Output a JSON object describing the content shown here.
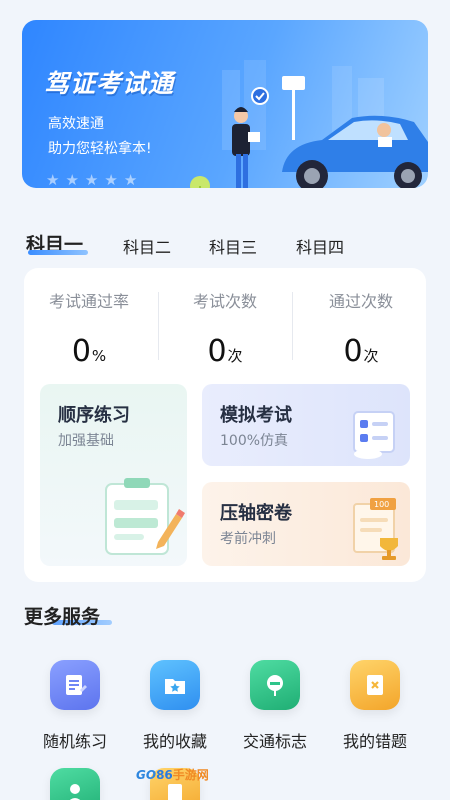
{
  "banner": {
    "title": "驾证考试通",
    "line1": "高效速通",
    "line2": "助力您轻松拿本!",
    "star_count": 5
  },
  "tabs": [
    {
      "label": "科目一",
      "active": true
    },
    {
      "label": "科目二",
      "active": false
    },
    {
      "label": "科目三",
      "active": false
    },
    {
      "label": "科目四",
      "active": false
    }
  ],
  "stats": [
    {
      "label": "考试通过率",
      "value": "0",
      "unit": "%"
    },
    {
      "label": "考试次数",
      "value": "0",
      "unit": "次"
    },
    {
      "label": "通过次数",
      "value": "0",
      "unit": "次"
    }
  ],
  "practice": {
    "sequential": {
      "title": "顺序练习",
      "subtitle": "加强基础"
    },
    "mock": {
      "title": "模拟考试",
      "subtitle": "100%仿真"
    },
    "final": {
      "title": "压轴密卷",
      "subtitle": "考前冲刺"
    }
  },
  "more_services": {
    "title": "更多服务",
    "items": [
      {
        "label": "随机练习",
        "icon": "random-practice-icon",
        "color": "#6f86f5"
      },
      {
        "label": "我的收藏",
        "icon": "favorites-folder-icon",
        "color": "#3aa6ef"
      },
      {
        "label": "交通标志",
        "icon": "traffic-sign-icon",
        "color": "#2fc48a"
      },
      {
        "label": "我的错题",
        "icon": "wrong-questions-icon",
        "color": "#f5b63a"
      }
    ]
  },
  "watermark": {
    "go": "GO",
    "mid": "86",
    "cn": "手游网"
  },
  "colors": {
    "accent": "#3a8dff",
    "background": "#f1f5fb"
  }
}
